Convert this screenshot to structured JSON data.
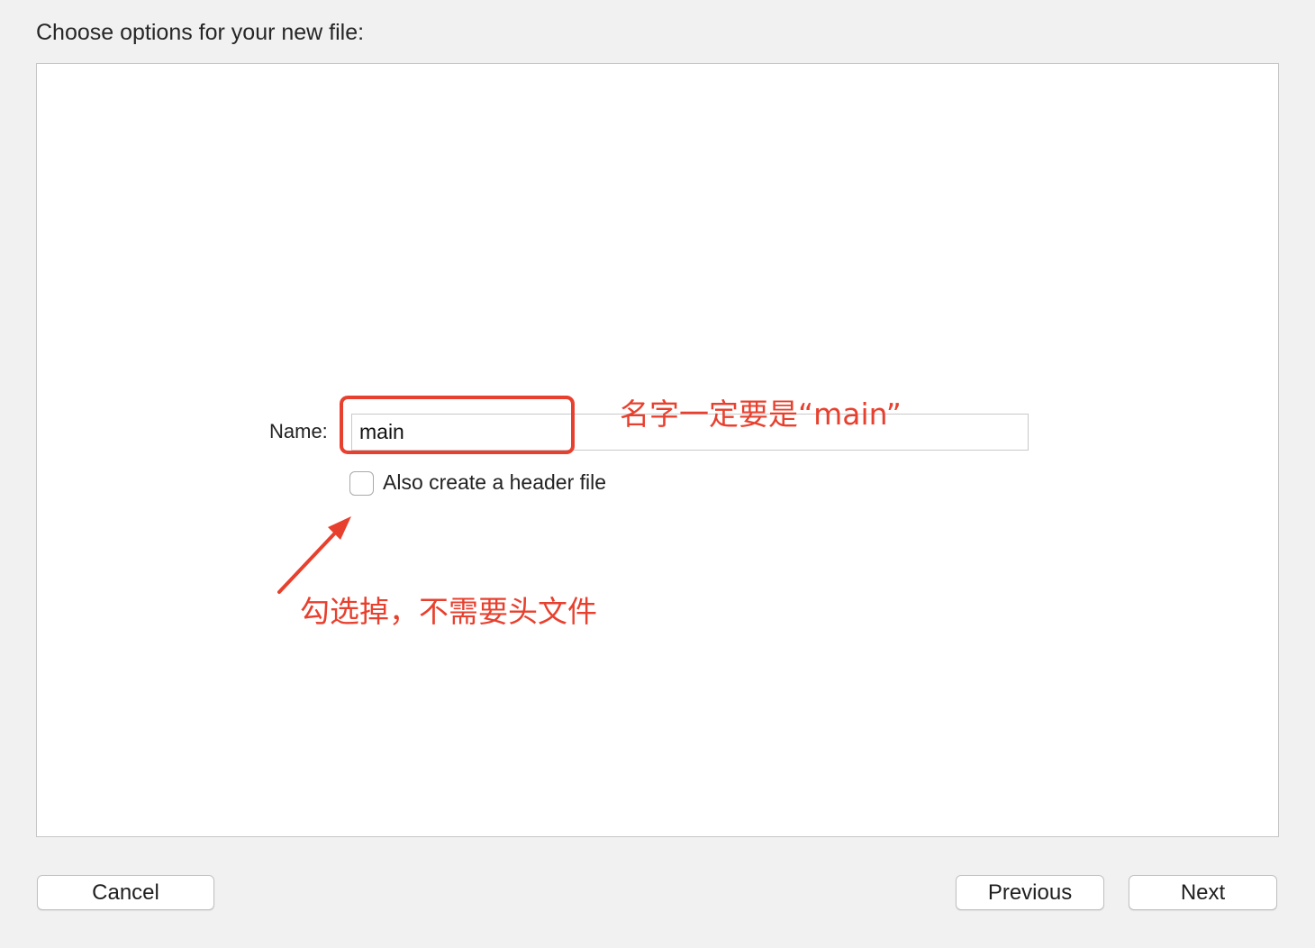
{
  "header": {
    "title": "Choose options for your new file:"
  },
  "form": {
    "name_label": "Name:",
    "name_value": "main",
    "header_checkbox_label": "Also create a header file",
    "header_checkbox_checked": false
  },
  "annotations": {
    "name_note": "名字一定要是“main”",
    "header_note": "勾选掉，不需要头文件",
    "color": "#e8402e"
  },
  "footer": {
    "cancel_label": "Cancel",
    "previous_label": "Previous",
    "next_label": "Next"
  }
}
